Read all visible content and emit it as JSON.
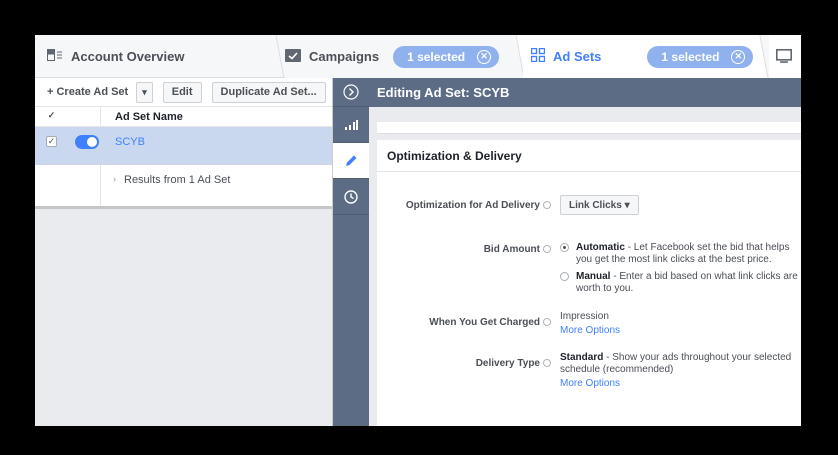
{
  "tabs": {
    "account_overview": "Account Overview",
    "campaigns": "Campaigns",
    "campaigns_chip": "1 selected",
    "ad_sets": "Ad Sets",
    "ad_sets_chip": "1 selected"
  },
  "toolbar": {
    "create_label": "+  Create Ad Set",
    "caret": "▾",
    "edit_label": "Edit",
    "duplicate_label": "Duplicate Ad Set..."
  },
  "table": {
    "column_header": "Ad Set Name",
    "row_name": "SCYB",
    "results_text": "Results from 1 Ad Set"
  },
  "editor": {
    "title": "Editing Ad Set: SCYB",
    "section_title": "Optimization & Delivery",
    "optimization_label": "Optimization for Ad Delivery",
    "optimization_value": "Link Clicks ▾",
    "bid_label": "Bid Amount",
    "bid_auto_bold": "Automatic",
    "bid_auto_text": " - Let Facebook set the bid that helps you get the most link clicks at the best price.",
    "bid_manual_bold": "Manual",
    "bid_manual_text": " - Enter a bid based on what link clicks are worth to you.",
    "charged_label": "When You Get Charged",
    "charged_value": "Impression",
    "charged_more": "More Options",
    "delivery_label": "Delivery Type",
    "delivery_bold": "Standard",
    "delivery_text": " - Show your ads throughout your selected schedule (recommended)",
    "delivery_more": "More Options"
  },
  "colors": {
    "accent": "#4080ff",
    "nav": "#5b6c84",
    "selected_row": "#c9d7ef"
  },
  "icons": [
    "table-icon",
    "folder-icon",
    "grid-icon",
    "close-icon",
    "expand-icon",
    "chart-icon",
    "pencil-icon",
    "clock-icon"
  ]
}
